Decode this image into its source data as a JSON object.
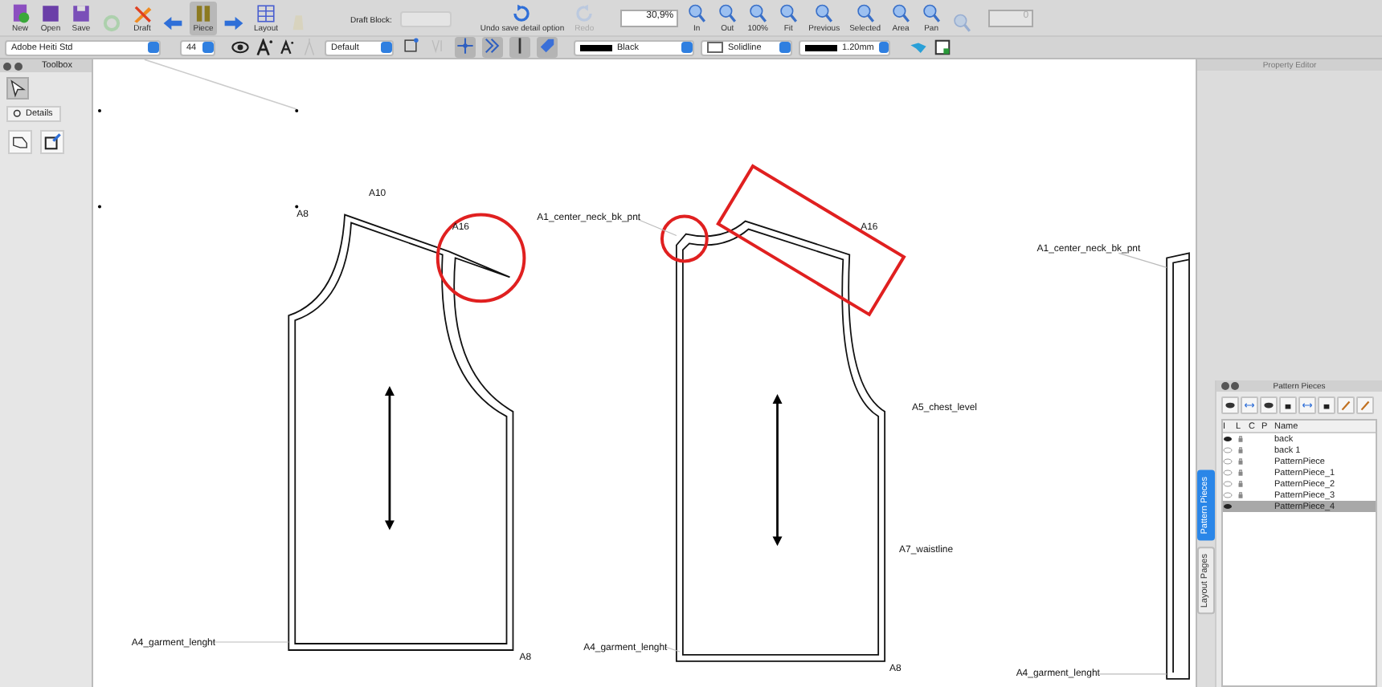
{
  "toolbar": {
    "buttons": [
      {
        "kind": "new",
        "label": "New",
        "disabled": false,
        "selected": false
      },
      {
        "kind": "open",
        "label": "Open",
        "disabled": false,
        "selected": false
      },
      {
        "kind": "save",
        "label": "Save",
        "disabled": false,
        "selected": false
      },
      {
        "kind": "refresh",
        "disabled": true,
        "selected": false
      },
      {
        "kind": "draft",
        "label": "Draft",
        "disabled": false,
        "selected": false
      },
      {
        "kind": "back",
        "disabled": false,
        "selected": false
      },
      {
        "kind": "piece",
        "label": "Piece",
        "disabled": false,
        "selected": true
      },
      {
        "kind": "forward",
        "disabled": false,
        "selected": false
      },
      {
        "kind": "layout",
        "label": "Layout",
        "disabled": false,
        "selected": false
      },
      {
        "kind": "group",
        "disabled": true,
        "selected": false
      }
    ],
    "draft_block": {
      "label": "Draft Block:",
      "disabled": true
    },
    "history": [
      {
        "kind": "undo",
        "label": "Undo save detail option",
        "disabled": false
      },
      {
        "kind": "redo",
        "label": "Redo",
        "disabled": true
      }
    ],
    "zoom_value": "30,9%",
    "zoom_buttons": [
      {
        "label": "In",
        "disabled": false
      },
      {
        "label": "Out",
        "disabled": false
      },
      {
        "label": "100%",
        "disabled": false
      },
      {
        "label": "Fit",
        "disabled": false
      },
      {
        "label": "Previous",
        "disabled": false
      },
      {
        "label": "Selected",
        "disabled": false
      },
      {
        "label": "Area",
        "disabled": false
      },
      {
        "label": "Pan",
        "disabled": false
      },
      {
        "disabled": true
      }
    ],
    "spinner_value": "0"
  },
  "format_bar": {
    "font": "Adobe Heiti Std",
    "size": "44",
    "style": "Default",
    "tools": [
      {
        "kind": "point",
        "selected": false
      },
      {
        "kind": "curve",
        "selected": false
      },
      {
        "kind": "cross",
        "selected": true
      },
      {
        "kind": "chevron",
        "selected": true
      },
      {
        "kind": "bar",
        "selected": true
      },
      {
        "kind": "tag",
        "selected": true
      }
    ],
    "pen_color": "Black",
    "line_type": "Solidline",
    "line_width": "1.20mm"
  },
  "toolbox": {
    "title": "Toolbox",
    "tab": "Details"
  },
  "property_editor": {
    "title": "Property Editor"
  },
  "canvas": {
    "labels": [
      "A8",
      "A10",
      "A16",
      "A4_garment_lenght",
      "A8",
      "A1_center_neck_bk_pnt",
      "A16",
      "A5_chest_level",
      "A7_waistline",
      "A4_garment_lenght",
      "A8",
      "A1_center_neck_bk_pnt",
      "A4_garment_lenght"
    ]
  },
  "side_tabs": [
    {
      "label": "Pattern Pieces",
      "selected": true
    },
    {
      "label": "Layout Pages",
      "selected": false
    }
  ],
  "pattern_pieces": {
    "title": "Pattern Pieces",
    "columns": [
      "I",
      "L",
      "C",
      "P",
      "Name"
    ],
    "rows": [
      {
        "name": "back",
        "visible": true,
        "locked": true,
        "selected": false
      },
      {
        "name": "back 1",
        "visible": false,
        "locked": true,
        "selected": false
      },
      {
        "name": "PatternPiece",
        "visible": false,
        "locked": true,
        "selected": false
      },
      {
        "name": "PatternPiece_1",
        "visible": false,
        "locked": true,
        "selected": false
      },
      {
        "name": "PatternPiece_2",
        "visible": false,
        "locked": true,
        "selected": false
      },
      {
        "name": "PatternPiece_3",
        "visible": false,
        "locked": true,
        "selected": false
      },
      {
        "name": "PatternPiece_4",
        "visible": true,
        "locked": false,
        "selected": true
      }
    ]
  }
}
